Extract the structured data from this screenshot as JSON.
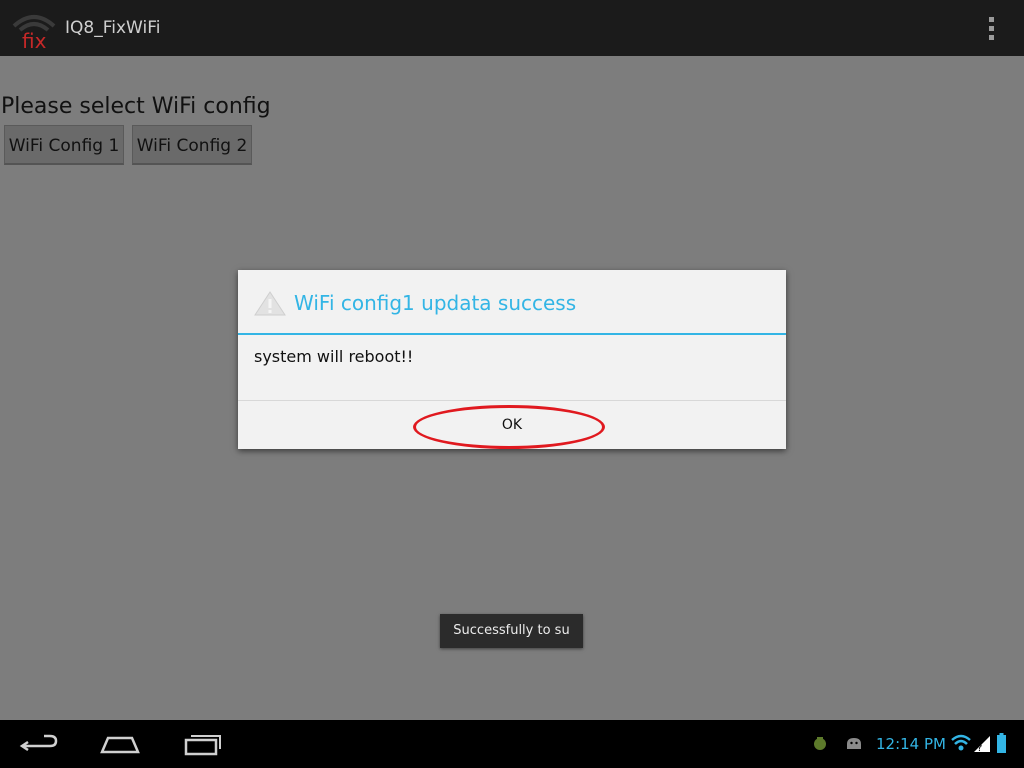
{
  "action_bar": {
    "icon_text": "fix",
    "title": "IQ8_FixWiFi",
    "icon": "overflow-menu-icon"
  },
  "content": {
    "prompt": "Please select WiFi config",
    "buttons": [
      {
        "label": "WiFi Config 1"
      },
      {
        "label": "WiFi Config 2"
      }
    ]
  },
  "dialog": {
    "icon": "warning-icon",
    "title": "WiFi config1 updata success",
    "message": "system will reboot!!",
    "ok_label": "OK"
  },
  "toast": {
    "text": "Successfully to su"
  },
  "system_bar": {
    "time": "12:14 PM",
    "nav_icons": [
      "back-icon",
      "home-icon",
      "recent-apps-icon"
    ],
    "notification_icons": [
      "android-debug-icon",
      "android-icon"
    ],
    "status_icons": [
      "wifi-icon",
      "signal-icon",
      "battery-icon"
    ]
  },
  "colors": {
    "accent": "#33b5e5",
    "highlight": "#e0191f",
    "icon_fix": "#c62828"
  }
}
